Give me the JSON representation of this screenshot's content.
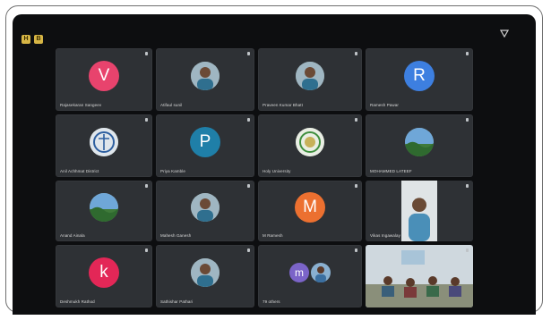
{
  "top_bar": {
    "left_buttons": [
      "H",
      "B"
    ],
    "right_icon": "signal-icon"
  },
  "participants": [
    {
      "name": "Rajasekaran Sangeev",
      "type": "letter",
      "letter": "V",
      "color": "#e8436d"
    },
    {
      "name": "Atifaul sunil",
      "type": "photo",
      "icon": "person-photo-icon"
    },
    {
      "name": "Praveen Kumar Bhatt",
      "type": "photo",
      "icon": "person-photo-icon"
    },
    {
      "name": "Ramesh Pawar",
      "type": "letter",
      "letter": "R",
      "color": "#3d7fe0"
    },
    {
      "name": "Anil Achhmat District",
      "type": "photo",
      "icon": "emblem-icon"
    },
    {
      "name": "Priya Kamble",
      "type": "letter",
      "letter": "P",
      "color": "#1f7fa8"
    },
    {
      "name": "Holy University",
      "type": "photo",
      "icon": "university-logo-icon"
    },
    {
      "name": "MOHAMMED LATEEF",
      "type": "photo",
      "icon": "landscape-photo-icon"
    },
    {
      "name": "Anand Ainala",
      "type": "photo",
      "icon": "landscape-photo-icon"
    },
    {
      "name": "Mahesh Ganesh",
      "type": "photo",
      "icon": "person-photo-icon"
    },
    {
      "name": "M Ramesh",
      "type": "letter",
      "letter": "M",
      "color": "#ec7030"
    },
    {
      "name": "Vikas Ingawalay",
      "type": "video",
      "icon": "video-feed-icon"
    },
    {
      "name": "Deshmukh Rathod",
      "type": "letter",
      "letter": "k",
      "color": "#e32757"
    },
    {
      "name": "Sathishar Pathari",
      "type": "photo",
      "icon": "person-photo-icon"
    },
    {
      "name": "79 others",
      "type": "group",
      "letter": "m",
      "color": "#7b64c8"
    },
    {
      "name": "",
      "type": "video",
      "icon": "conference-room-video-icon"
    }
  ]
}
